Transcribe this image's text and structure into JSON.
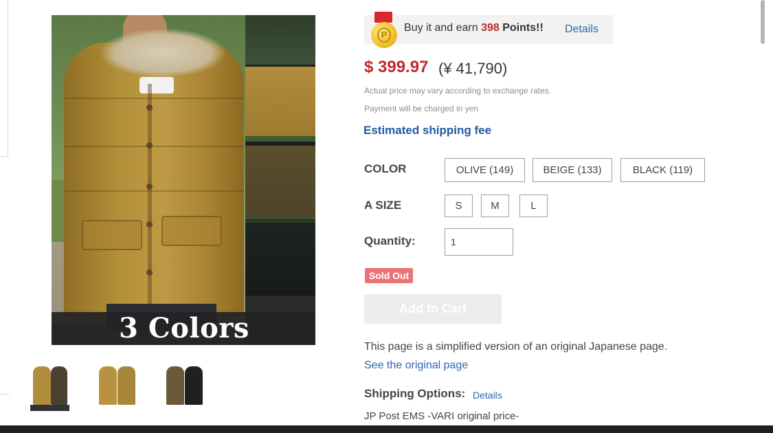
{
  "gallery": {
    "main_caption": "3 Colors",
    "thumbnails": [
      "thumbnail-1",
      "thumbnail-2",
      "thumbnail-3"
    ]
  },
  "points": {
    "prefix": "Buy it and earn",
    "amount": "398",
    "unit": "Points!!",
    "details_label": "Details",
    "medal_letter": "P"
  },
  "price": {
    "usd": "$ 399.97",
    "jpy": "(¥ 41,790)",
    "note_exchange": "Actual price may vary according to exchange rates.",
    "note_currency": "Payment will be charged in yen",
    "shipping_fee_link": "Estimated shipping fee"
  },
  "options": {
    "color_label": "COLOR",
    "colors": [
      "OLIVE (149)",
      "BEIGE (133)",
      "BLACK (119)"
    ],
    "size_label": "A SIZE",
    "sizes": [
      "S",
      "M",
      "L"
    ],
    "quantity_label": "Quantity:",
    "quantity_value": "1"
  },
  "status": {
    "sold_out": "Sold Out",
    "add_to_cart": "Add to Cart"
  },
  "footer": {
    "simplified_notice": "This page is a simplified version of an original Japanese page.",
    "see_original": "See the original page",
    "shipping_options_label": "Shipping Options:",
    "shipping_details": "Details",
    "shipping_method": "JP Post EMS -VARI original price-"
  },
  "colors": {
    "price_red": "#c0292d",
    "link_blue": "#2b68b0",
    "sold_out_bg": "#ec7373",
    "disabled_button": "#ececec"
  }
}
